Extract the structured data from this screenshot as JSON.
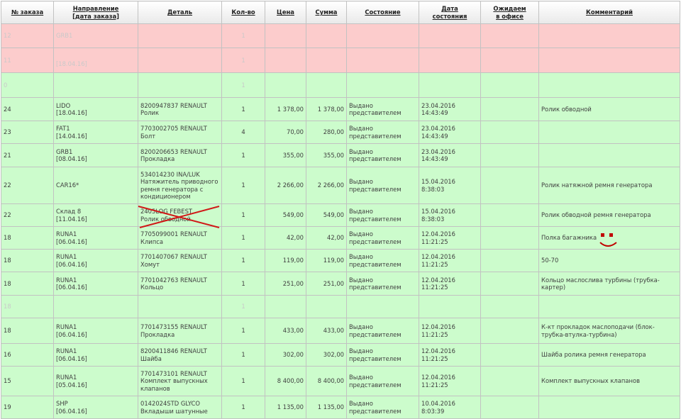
{
  "columns": [
    {
      "label": "№ заказа",
      "sub": "",
      "link": true
    },
    {
      "label": "Направление",
      "sub": "[дата заказа]",
      "link": true
    },
    {
      "label": "Деталь",
      "sub": "",
      "link": true
    },
    {
      "label": "Кол-во",
      "sub": "",
      "link": true
    },
    {
      "label": "Цена",
      "sub": "",
      "link": true
    },
    {
      "label": "Сумма",
      "sub": "",
      "link": true
    },
    {
      "label": "Состояние",
      "sub": "",
      "link": true
    },
    {
      "label": "Дата",
      "sub": "состояния",
      "link": true
    },
    {
      "label": "Ожидаем",
      "sub": "в офисе",
      "link": true
    },
    {
      "label": "Комментарий",
      "sub": "",
      "link": true
    }
  ],
  "rows": [
    {
      "color": "pink",
      "faded": true,
      "id": "12",
      "dir": [
        "GRB1",
        ""
      ],
      "detail": [
        "",
        ""
      ],
      "qty": "1",
      "price": "",
      "sum": "",
      "state": [
        "",
        ""
      ],
      "date": [
        "",
        ""
      ],
      "comment": ""
    },
    {
      "color": "pink",
      "faded": true,
      "id": "11",
      "dir": [
        "",
        "[18.04.16]"
      ],
      "detail": [
        "",
        ""
      ],
      "qty": "1",
      "price": "",
      "sum": "",
      "state": [
        "",
        ""
      ],
      "date": [
        "",
        ""
      ],
      "comment": ""
    },
    {
      "color": "green",
      "faded": true,
      "id": "0",
      "dir": [
        "",
        ""
      ],
      "detail": [
        "",
        ""
      ],
      "qty": "1",
      "price": "",
      "sum": "",
      "state": [
        "",
        ""
      ],
      "date": [
        "",
        ""
      ],
      "comment": ""
    },
    {
      "color": "green",
      "id": "24",
      "dir": [
        "LIDO",
        "[18.04.16]"
      ],
      "detail": [
        "8200947837 RENAULT",
        "Ролик"
      ],
      "qty": "1",
      "price": "1 378,00",
      "sum": "1 378,00",
      "state": [
        "Выдано",
        "представителем"
      ],
      "date": [
        "23.04.2016",
        "14:43:49"
      ],
      "comment": "Ролик обводной"
    },
    {
      "color": "green",
      "id": "23",
      "dir": [
        "FAT1",
        "[14.04.16]"
      ],
      "detail": [
        "7703002705 RENAULT",
        "Болт"
      ],
      "qty": "4",
      "price": "70,00",
      "sum": "280,00",
      "state": [
        "Выдано",
        "представителем"
      ],
      "date": [
        "23.04.2016",
        "14:43:49"
      ],
      "comment": ""
    },
    {
      "color": "green",
      "id": "21",
      "dir": [
        "GRB1",
        "[08.04.16]"
      ],
      "detail": [
        "8200206653 RENAULT",
        "Прокладка"
      ],
      "qty": "1",
      "price": "355,00",
      "sum": "355,00",
      "state": [
        "Выдано",
        "представителем"
      ],
      "date": [
        "23.04.2016",
        "14:43:49"
      ],
      "comment": ""
    },
    {
      "color": "green",
      "id": "22",
      "dir": [
        "CAR16*",
        ""
      ],
      "detail": [
        "534014230 INA/LUK",
        "Натяжитель приводного",
        "ремня генератора с",
        "кондиционером"
      ],
      "qty": "1",
      "price": "2 266,00",
      "sum": "2 266,00",
      "state": [
        "Выдано",
        "представителем"
      ],
      "date": [
        "15.04.2016",
        "8:38:03"
      ],
      "comment": "Ролик натяжной ремня генератора"
    },
    {
      "color": "green",
      "id": "22",
      "dir": [
        "Склад 8",
        "[11.04.16]"
      ],
      "detail": [
        "2405LOG FEBEST",
        "Ролик обводной"
      ],
      "qty": "1",
      "price": "549,00",
      "sum": "549,00",
      "state": [
        "Выдано",
        "представителем"
      ],
      "date": [
        "15.04.2016",
        "8:38:03"
      ],
      "comment": "Ролик обводной ремня генератора"
    },
    {
      "color": "green",
      "id": "18",
      "dir": [
        "RUNA1",
        "[06.04.16]"
      ],
      "detail": [
        "7705099001 RENAULT",
        "Клипса"
      ],
      "qty": "1",
      "price": "42,00",
      "sum": "42,00",
      "state": [
        "Выдано",
        "представителем"
      ],
      "date": [
        "12.04.2016",
        "11:21:25"
      ],
      "comment": "Полка багажника"
    },
    {
      "color": "green",
      "id": "18",
      "dir": [
        "RUNA1",
        "[06.04.16]"
      ],
      "detail": [
        "7701407067 RENAULT",
        "Хомут"
      ],
      "qty": "1",
      "price": "119,00",
      "sum": "119,00",
      "state": [
        "Выдано",
        "представителем"
      ],
      "date": [
        "12.04.2016",
        "11:21:25"
      ],
      "comment": "50-70"
    },
    {
      "color": "green",
      "id": "18",
      "dir": [
        "RUNA1",
        "[06.04.16]"
      ],
      "detail": [
        "7701042763 RENAULT",
        "Кольцо"
      ],
      "qty": "1",
      "price": "251,00",
      "sum": "251,00",
      "state": [
        "Выдано",
        "представителем"
      ],
      "date": [
        "12.04.2016",
        "11:21:25"
      ],
      "comment": "Кольцо маслослива турбины (трубка-картер)"
    },
    {
      "color": "green",
      "faded": true,
      "id": "18",
      "dir": [
        "",
        ""
      ],
      "detail": [
        "",
        ""
      ],
      "qty": "1",
      "price": "",
      "sum": "",
      "state": [
        "",
        ""
      ],
      "date": [
        "",
        ""
      ],
      "comment": ""
    },
    {
      "color": "green",
      "id": "18",
      "dir": [
        "RUNA1",
        "[06.04.16]"
      ],
      "detail": [
        "7701473155 RENAULT",
        "Прокладка"
      ],
      "qty": "1",
      "price": "433,00",
      "sum": "433,00",
      "state": [
        "Выдано",
        "представителем"
      ],
      "date": [
        "12.04.2016",
        "11:21:25"
      ],
      "comment": "К-кт прокладок маслоподачи (блок-трубка-втулка-турбина)"
    },
    {
      "color": "green",
      "id": "16",
      "dir": [
        "RUNA1",
        "[06.04.16]"
      ],
      "detail": [
        "8200411846 RENAULT",
        "Шайба"
      ],
      "qty": "1",
      "price": "302,00",
      "sum": "302,00",
      "state": [
        "Выдано",
        "представителем"
      ],
      "date": [
        "12.04.2016",
        "11:21:25"
      ],
      "comment": "Шайба ролика ремня генератора"
    },
    {
      "color": "green",
      "id": "15",
      "dir": [
        "RUNA1",
        "[05.04.16]"
      ],
      "detail": [
        "7701473101 RENAULT",
        "Комплект выпускных",
        "клапанов"
      ],
      "qty": "1",
      "price": "8 400,00",
      "sum": "8 400,00",
      "state": [
        "Выдано",
        "представителем"
      ],
      "date": [
        "12.04.2016",
        "11:21:25"
      ],
      "comment": "Комплект выпускных клапанов"
    },
    {
      "color": "green",
      "id": "19",
      "dir": [
        "SHP",
        "[06.04.16]"
      ],
      "detail": [
        "0142024STD GLYCO",
        "Вкладыши шатунные"
      ],
      "qty": "1",
      "price": "1 135,00",
      "sum": "1 135,00",
      "state": [
        "Выдано",
        "представителем"
      ],
      "date": [
        "10.04.2016",
        "8:03:39"
      ],
      "comment": ""
    }
  ],
  "colors": {
    "green_row": "#ccfccc",
    "pink_row": "#fccccc",
    "cross": "#d01818",
    "smiley": "#c00000"
  }
}
